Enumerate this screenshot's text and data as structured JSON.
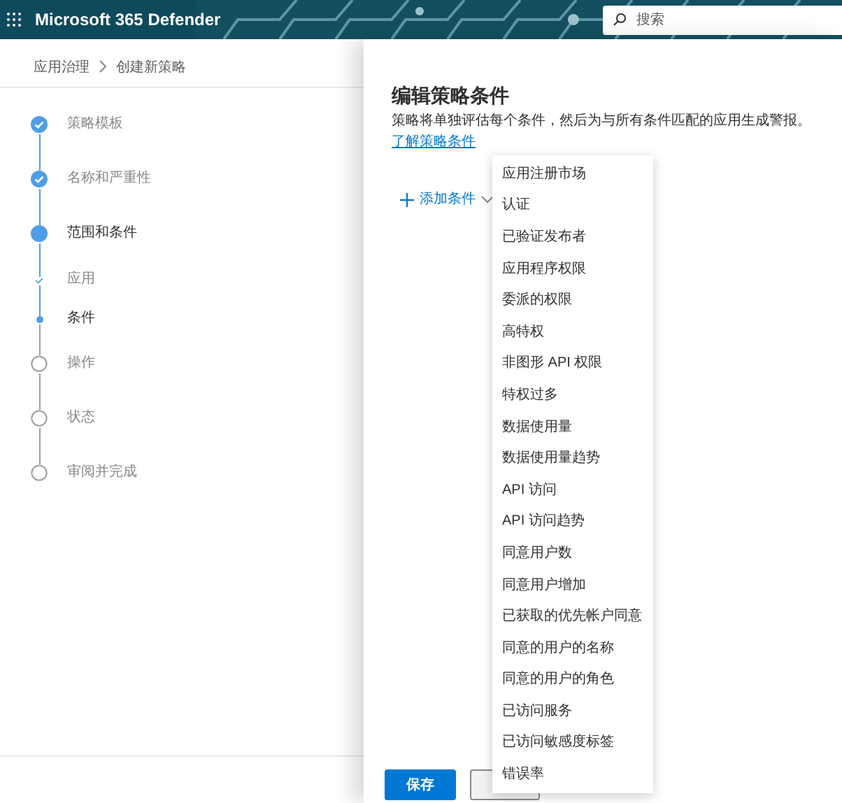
{
  "header": {
    "app_title": "Microsoft 365 Defender",
    "search": {
      "placeholder": "搜索"
    }
  },
  "breadcrumb": [
    "应用治理",
    "创建新策略"
  ],
  "steps": [
    {
      "label": "策略模板",
      "kind": "done"
    },
    {
      "label": "名称和严重性",
      "kind": "done"
    },
    {
      "label": "范围和条件",
      "kind": "current"
    },
    {
      "label": "应用",
      "kind": "sub-done"
    },
    {
      "label": "条件",
      "kind": "sub-current"
    },
    {
      "label": "操作",
      "kind": "pending"
    },
    {
      "label": "状态",
      "kind": "pending"
    },
    {
      "label": "审阅并完成",
      "kind": "pending"
    }
  ],
  "panel": {
    "title": "编辑策略条件",
    "description": "策略将单独评估每个条件，然后为与所有条件匹配的应用生成警报。",
    "link": "了解策略条件",
    "add_condition": "添加条件",
    "save": "保存"
  },
  "condition_menu": [
    "应用注册市场",
    "认证",
    "已验证发布者",
    "应用程序权限",
    "委派的权限",
    "高特权",
    "非图形 API 权限",
    "特权过多",
    "数据使用量",
    "数据使用量趋势",
    "API 访问",
    "API 访问趋势",
    "同意用户数",
    "同意用户增加",
    "已获取的优先帐户同意",
    "同意的用户的名称",
    "同意的用户的角色",
    "已访问服务",
    "已访问敏感度标签",
    "错误率"
  ]
}
